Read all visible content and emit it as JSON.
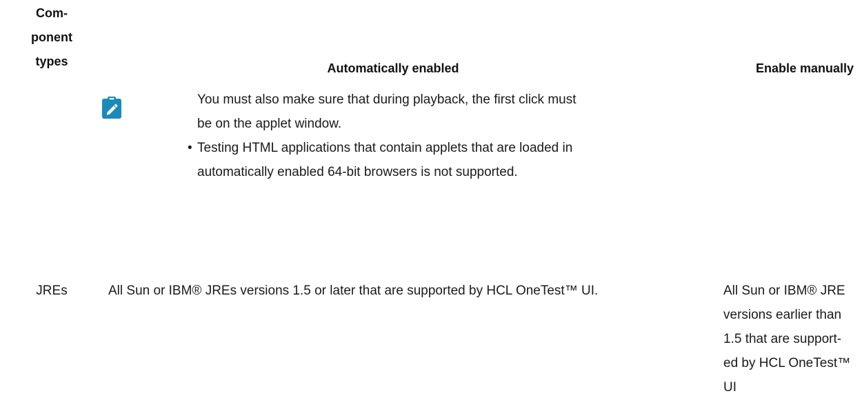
{
  "table": {
    "headers": {
      "component_types": [
        "Com-",
        "ponent",
        "types"
      ],
      "automatically_enabled": "Automatically enabled",
      "enable_manually": "Enable manually"
    },
    "note": {
      "icon": "note-pencil-icon",
      "icon_color": "#1a8ab8",
      "lines": [
        "You must also make sure that during playback, the first click must",
        "be on the applet window."
      ]
    },
    "bullet": {
      "symbol": "•",
      "lines": [
        "Testing HTML applications that contain applets that are loaded in",
        "automatically enabled 64-bit browsers is not supported."
      ]
    },
    "rows": [
      {
        "component": "JREs",
        "automatically_enabled": "All Sun or IBM® JREs versions 1.5 or later that are supported by HCL OneTest™ UI.",
        "enable_manually_lines": [
          "All Sun or IBM® JRE",
          "versions earlier than",
          "1.5 that are support-",
          "ed by HCL OneTest™",
          "UI"
        ]
      }
    ]
  }
}
